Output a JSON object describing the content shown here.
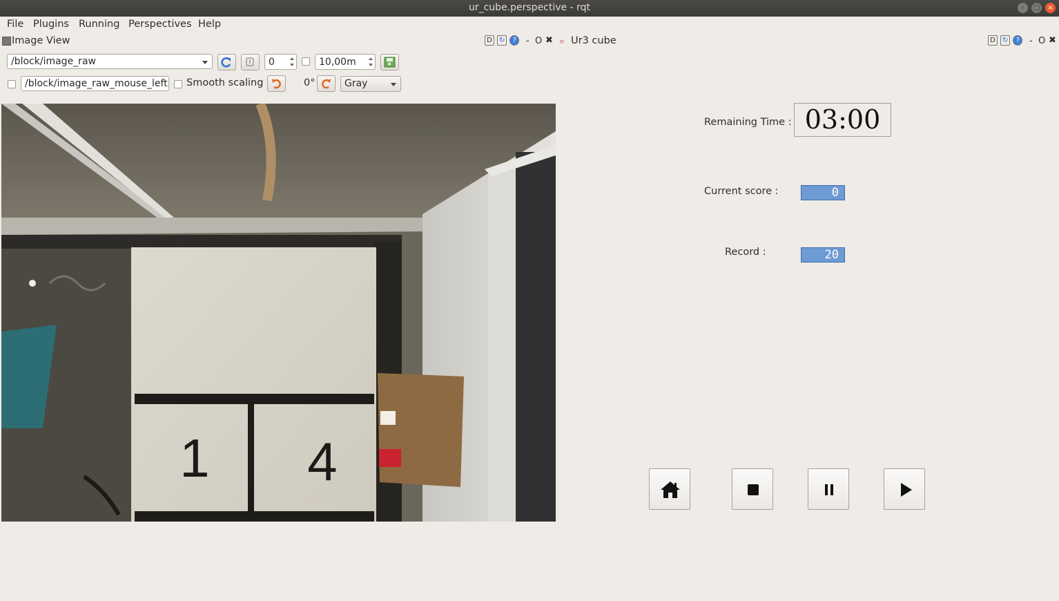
{
  "window": {
    "title": "ur_cube.perspective - rqt"
  },
  "menu": [
    "File",
    "Plugins",
    "Running",
    "Perspectives",
    "Help"
  ],
  "image_view": {
    "title": "Image View",
    "dock_buttons": "D",
    "dock_close_label": "O",
    "topic": "/block/image_raw",
    "spin_value": "0",
    "duration_value": "10,00m",
    "mouse_topic": "/block/image_raw_mouse_left",
    "smooth_scaling_label": "Smooth scaling",
    "rotation": "0°",
    "color_scheme": "Gray"
  },
  "ur3_cube": {
    "title": "Ur3 cube",
    "dock_buttons": "D",
    "dock_close_label": "O",
    "remaining_time_label": "Remaining Time :",
    "remaining_time": "03:00",
    "current_score_label": "Current score :",
    "current_score": "0",
    "record_label": "Record :",
    "record": "20"
  },
  "camera": {
    "label_left": "1",
    "label_right": "4"
  },
  "colors": {
    "lcd": "#6f9bd4",
    "close_button": "#ec5d30"
  },
  "icons": [
    "home-icon",
    "stop-icon",
    "pause-icon",
    "play-icon",
    "refresh-icon",
    "save-icon",
    "rotate-left-icon",
    "rotate-right-icon"
  ]
}
